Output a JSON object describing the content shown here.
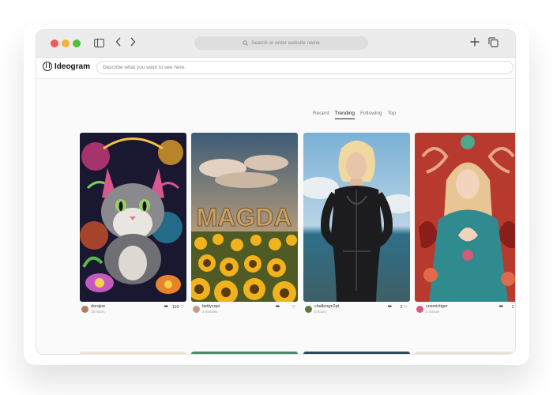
{
  "browser": {
    "url_placeholder": "Search or enter website name"
  },
  "app": {
    "name": "Ideogram",
    "prompt_placeholder": "Describe what you want to see here."
  },
  "tabs": [
    {
      "label": "Recent",
      "active": false
    },
    {
      "label": "Trending",
      "active": true
    },
    {
      "label": "Following",
      "active": false
    },
    {
      "label": "Top",
      "active": false
    }
  ],
  "cards": [
    {
      "user": "dorajoe",
      "time": "18 hours",
      "likes": "110",
      "image": "colorful kitten with flowers"
    },
    {
      "user": "bettycapi",
      "time": "2 minutes",
      "likes": "",
      "image": "MAGDA letters in sunflower field"
    },
    {
      "user": "challenge2pt",
      "time": "5 hours",
      "likes": "2",
      "image": "woman in black leather suit by sea"
    },
    {
      "user": "cosmictiger",
      "time": "a minute",
      "likes": "1",
      "image": "woman in teal dress praying"
    }
  ],
  "colors": {
    "accent": "#222222",
    "window_bg": "#fafafa"
  }
}
